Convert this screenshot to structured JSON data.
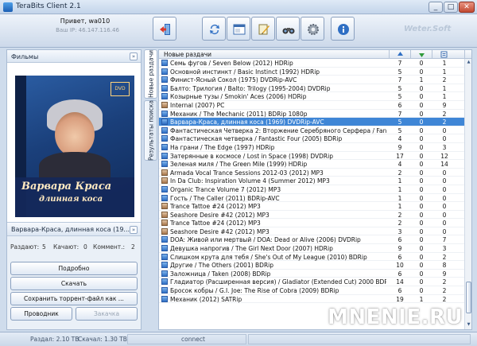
{
  "window": {
    "title": "TeraBits Client 2.1",
    "controls": [
      "_",
      "□",
      "✕"
    ]
  },
  "header": {
    "greeting": "Привет, wa010",
    "ip_line": "Ваш IP: 46.147.116.46",
    "watermark": "Weter.Soft",
    "toolbar_icons": [
      "exit-icon",
      "refresh-icon",
      "window-icon",
      "edit-icon",
      "binoculars-icon",
      "gear-icon",
      "info-icon"
    ]
  },
  "left": {
    "films_label": "Фильмы",
    "poster": {
      "title_line1": "Варвара Краса",
      "title_line2": "длинная коса",
      "stamp": "DVD"
    },
    "selected_title": "Варвара-Краса, длинная коса (19...",
    "stats": {
      "distributing_label": "Раздают:",
      "distributing": "5",
      "downloaded_label": "Качают:",
      "downloaded": "0",
      "comments_label": "Коммент.:",
      "comments": "2"
    },
    "buttons": {
      "details": "Подробно",
      "download": "Скачать",
      "save_torrent": "Сохранить торрент-файл как ...",
      "explorer": "Проводник",
      "bookmark": "Закачка"
    }
  },
  "tabs": {
    "new": "Новые раздачи",
    "search": "Результаты поиска"
  },
  "grid": {
    "header": "Новые раздачи",
    "rows": [
      {
        "title": "Семь фугов / Seven Below (2012) HDRip",
        "a": "7",
        "b": "0",
        "c": "1",
        "type": "blue"
      },
      {
        "title": "Основной инстинкт / Basic Instinct (1992) HDRip",
        "a": "5",
        "b": "0",
        "c": "1",
        "type": "blue"
      },
      {
        "title": "Финист-Ясный Сокол (1975) DVDRip-AVC",
        "a": "7",
        "b": "1",
        "c": "2",
        "type": "blue"
      },
      {
        "title": "Балто: Трилогия / Balto: Trilogy (1995-2004) DVDRip",
        "a": "5",
        "b": "0",
        "c": "1",
        "type": "blue"
      },
      {
        "title": "Козырные тузы / Smokin' Aces (2006) HDRip",
        "a": "5",
        "b": "0",
        "c": "1",
        "type": "blue"
      },
      {
        "title": "Internal (2007) PC",
        "a": "6",
        "b": "0",
        "c": "9",
        "type": "alt"
      },
      {
        "title": "Механик / The Mechanic (2011) BDRip 1080p",
        "a": "7",
        "b": "0",
        "c": "2",
        "type": "blue"
      },
      {
        "title": "Варвара-Краса, длинная коса (1969) DVDRip-AVC",
        "a": "5",
        "b": "0",
        "c": "2",
        "type": "blue",
        "selected": true
      },
      {
        "title": "Фантастическая Четверка 2: Вторжение Серебряного Серфера / Fantastic Fo...",
        "a": "5",
        "b": "0",
        "c": "0",
        "type": "blue"
      },
      {
        "title": "Фантастическая четверка / Fantastic Four (2005) BDRip",
        "a": "4",
        "b": "0",
        "c": "0",
        "type": "blue"
      },
      {
        "title": "На грани / The Edge (1997) HDRip",
        "a": "9",
        "b": "0",
        "c": "3",
        "type": "blue"
      },
      {
        "title": "Затерянные в космосе / Lost in Space (1998) DVDRip",
        "a": "17",
        "b": "0",
        "c": "12",
        "type": "blue"
      },
      {
        "title": "Зеленая миля / The Green Mile (1999) HDRip",
        "a": "4",
        "b": "0",
        "c": "14",
        "type": "blue"
      },
      {
        "title": "Armada Vocal Trance Sessions 2012-03 (2012) MP3",
        "a": "2",
        "b": "0",
        "c": "0",
        "type": "alt"
      },
      {
        "title": "In Da Club: Inspiration Volume 4 (Summer 2012) MP3",
        "a": "1",
        "b": "0",
        "c": "0",
        "type": "alt"
      },
      {
        "title": "Organic Trance Volume 7 (2012) MP3",
        "a": "1",
        "b": "0",
        "c": "0",
        "type": "blue"
      },
      {
        "title": "Гость / The Caller (2011) BDRip-AVC",
        "a": "1",
        "b": "0",
        "c": "0",
        "type": "blue"
      },
      {
        "title": "Trance Tattoe #24 (2012) MP3",
        "a": "1",
        "b": "0",
        "c": "0",
        "type": "alt"
      },
      {
        "title": "Seashore Desire #42 (2012) MP3",
        "a": "2",
        "b": "0",
        "c": "0",
        "type": "alt"
      },
      {
        "title": "Trance Tattoe #24 (2012) MP3",
        "a": "2",
        "b": "0",
        "c": "0",
        "type": "alt"
      },
      {
        "title": "Seashore Desire #42 (2012) MP3",
        "a": "3",
        "b": "0",
        "c": "0",
        "type": "alt"
      },
      {
        "title": "DOA: Живой или мертвый / DOA: Dead or Alive (2006) DVDRip",
        "a": "6",
        "b": "0",
        "c": "7",
        "type": "blue"
      },
      {
        "title": "Девушка напрогив / The Girl Next Door (2007) HDRip",
        "a": "9",
        "b": "0",
        "c": "3",
        "type": "blue"
      },
      {
        "title": "Слишком крута для тебя / She's Out of My League (2010) BDRip",
        "a": "6",
        "b": "0",
        "c": "2",
        "type": "blue"
      },
      {
        "title": "Другие / The Others (2001) BDRip",
        "a": "10",
        "b": "0",
        "c": "8",
        "type": "blue"
      },
      {
        "title": "Заложница / Taken (2008) BDRip",
        "a": "6",
        "b": "0",
        "c": "9",
        "type": "blue"
      },
      {
        "title": "Гладиатор (Расширенная версия) / Gladiator (Extended Cut) 2000 BDRip",
        "a": "14",
        "b": "0",
        "c": "2",
        "type": "blue"
      },
      {
        "title": "Бросок кобры / G.I. Joe: The Rise of Cobra (2009) BDRip",
        "a": "6",
        "b": "0",
        "c": "2",
        "type": "blue"
      },
      {
        "title": "Механик (2012) SATRip",
        "a": "19",
        "b": "1",
        "c": "2",
        "type": "blue"
      }
    ]
  },
  "status": {
    "distributed": "Раздал: 2.10 TB",
    "downloaded": "Скачал: 1.30 TB",
    "connection": "connect"
  },
  "brand": "MNENIE.RU",
  "colors": {
    "selection": "#3f86d6",
    "accent": "#2f6fc4"
  }
}
